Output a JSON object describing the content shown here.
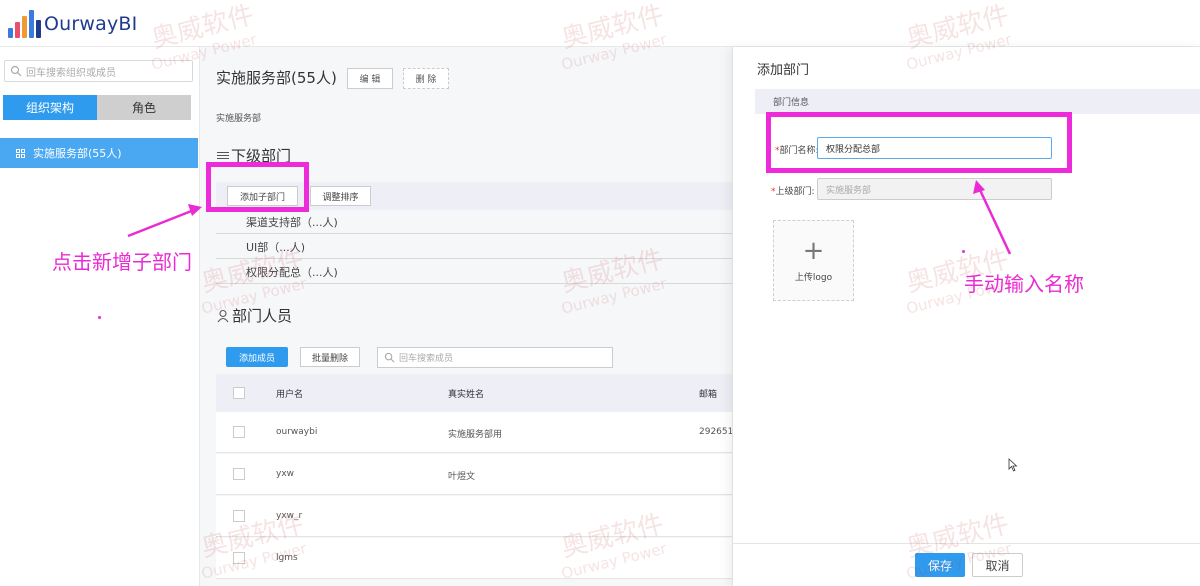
{
  "app": {
    "brand_name": "OurwayBI",
    "logo_colors": [
      "#e84f6d",
      "#f09a35",
      "#3a7be0",
      "#1f3b8f"
    ]
  },
  "sidebar": {
    "search_placeholder": "回车搜索组织或成员",
    "tabs": [
      {
        "label": "组织架构",
        "active": true
      },
      {
        "label": "角色",
        "active": false
      }
    ],
    "tree": [
      {
        "label": "实施服务部(55人)",
        "selected": true
      }
    ]
  },
  "main": {
    "dept_title": "实施服务部(55人)",
    "edit_label": "编 辑",
    "delete_label": "删 除",
    "breadcrumb": "实施服务部",
    "sub_dept_section": {
      "title": "下级部门",
      "add_label": "添加子部门",
      "sort_label": "调整排序",
      "items": [
        "渠道支持部（...人)",
        "UI部（...人)",
        "权限分配总（...人)"
      ]
    },
    "members_section": {
      "title": "部门人员",
      "add_label": "添加成员",
      "batch_delete_label": "批量删除",
      "search_placeholder": "回车搜索成员",
      "columns": [
        "用户名",
        "真实姓名",
        "邮箱"
      ],
      "rows": [
        {
          "username": "ourwaybi",
          "realname": "实施服务部用",
          "email": "292651"
        },
        {
          "username": "yxw",
          "realname": "叶煜文",
          "email": ""
        },
        {
          "username": "yxw_r",
          "realname": "",
          "email": ""
        },
        {
          "username": "lgms",
          "realname": "",
          "email": ""
        }
      ]
    }
  },
  "panel": {
    "title": "添加部门",
    "section_label": "部门信息",
    "name_label": "部门名称:",
    "name_value": "权限分配总部",
    "parent_label": "上级部门:",
    "parent_value": "实施服务部",
    "upload_plus": "+",
    "upload_label": "上传logo",
    "save_label": "保存",
    "cancel_label": "取消"
  },
  "annotations": {
    "left_text": "点击新增子部门",
    "right_text": "手动输入名称",
    "color": "#ea2bd3"
  },
  "watermark": {
    "cn": "奥威软件",
    "en": "Ourway Power"
  },
  "colors": {
    "primary": "#2e9bef",
    "sidebar_selected": "#4aa8f2",
    "highlight": "#ee2bd9"
  }
}
